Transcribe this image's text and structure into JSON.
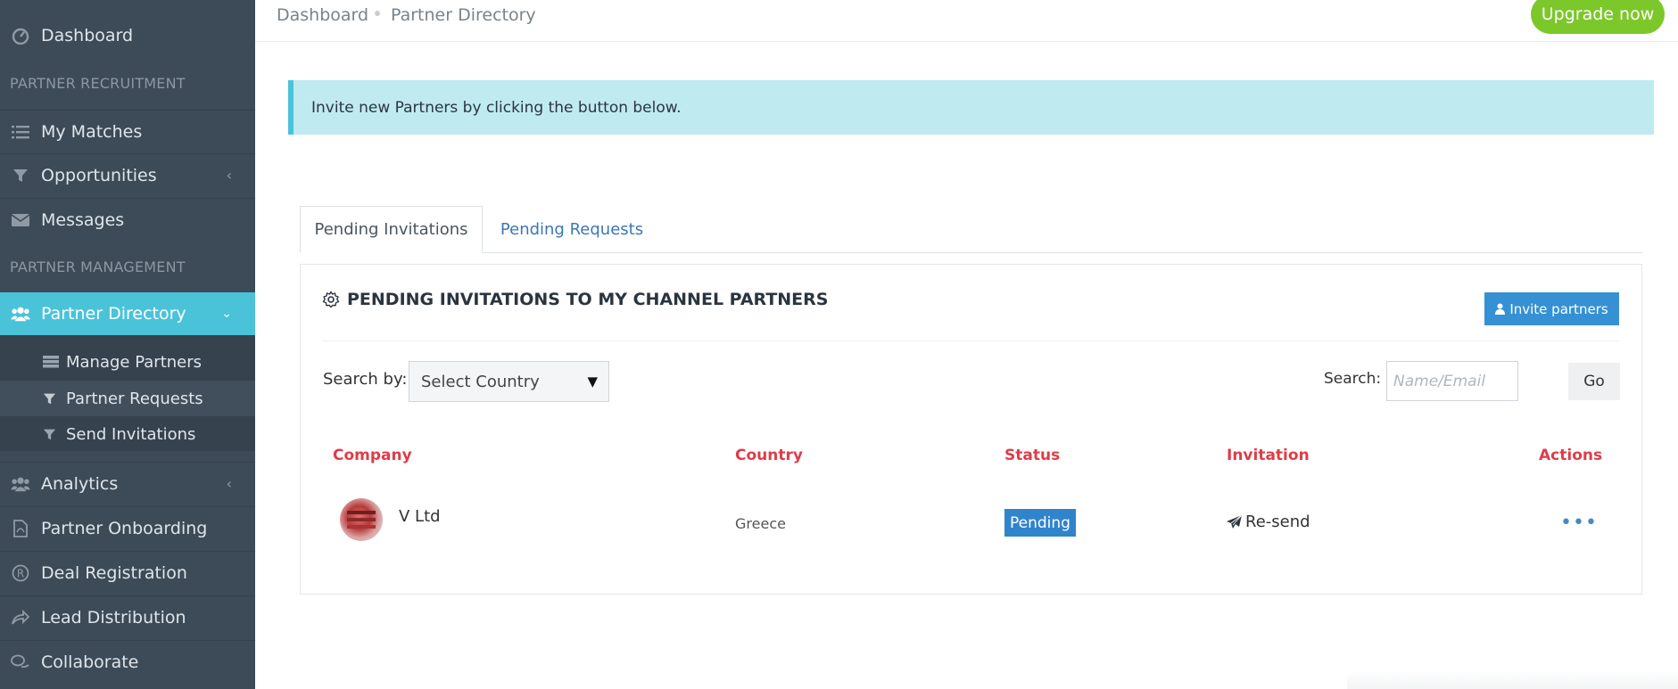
{
  "sidebar": {
    "dashboard": "Dashboard",
    "section_recruitment": "PARTNER RECRUITMENT",
    "my_matches": "My Matches",
    "opportunities": "Opportunities",
    "messages": "Messages",
    "section_management": "PARTNER MANAGEMENT",
    "partner_directory": "Partner Directory",
    "sub_items": [
      "Manage Partners",
      "Partner Requests",
      "Send Invitations"
    ],
    "analytics": "Analytics",
    "partner_onboarding": "Partner Onboarding",
    "deal_registration": "Deal Registration",
    "lead_distribution": "Lead Distribution",
    "collaborate": "Collaborate"
  },
  "header": {
    "breadcrumb": [
      "Dashboard",
      "Partner Directory"
    ],
    "upgrade_label": "Upgrade now"
  },
  "alert": {
    "text": "Invite new Partners by clicking the button below."
  },
  "tabs": [
    "Pending Invitations",
    "Pending Requests"
  ],
  "panel": {
    "title": "PENDING INVITATIONS TO MY CHANNEL PARTNERS",
    "invite_label": "Invite partners",
    "search_by_label": "Search by:",
    "country_select_value": "Select Country",
    "search_label": "Search:",
    "search_placeholder": "Name/Email",
    "go_label": "Go"
  },
  "table": {
    "headers": [
      "Company",
      "Country",
      "Status",
      "Invitation",
      "Actions"
    ],
    "rows": [
      {
        "company": "V Ltd",
        "country": "Greece",
        "status": "Pending",
        "invitation": "Re-send"
      }
    ]
  },
  "colors": {
    "sidebar_bg": "#3d4a57",
    "active_nav": "#4ac3d9",
    "upgrade": "#7cc72a",
    "header_red": "#e03c47",
    "primary_blue": "#3591d4",
    "alert_bg": "#bfeaf0"
  }
}
